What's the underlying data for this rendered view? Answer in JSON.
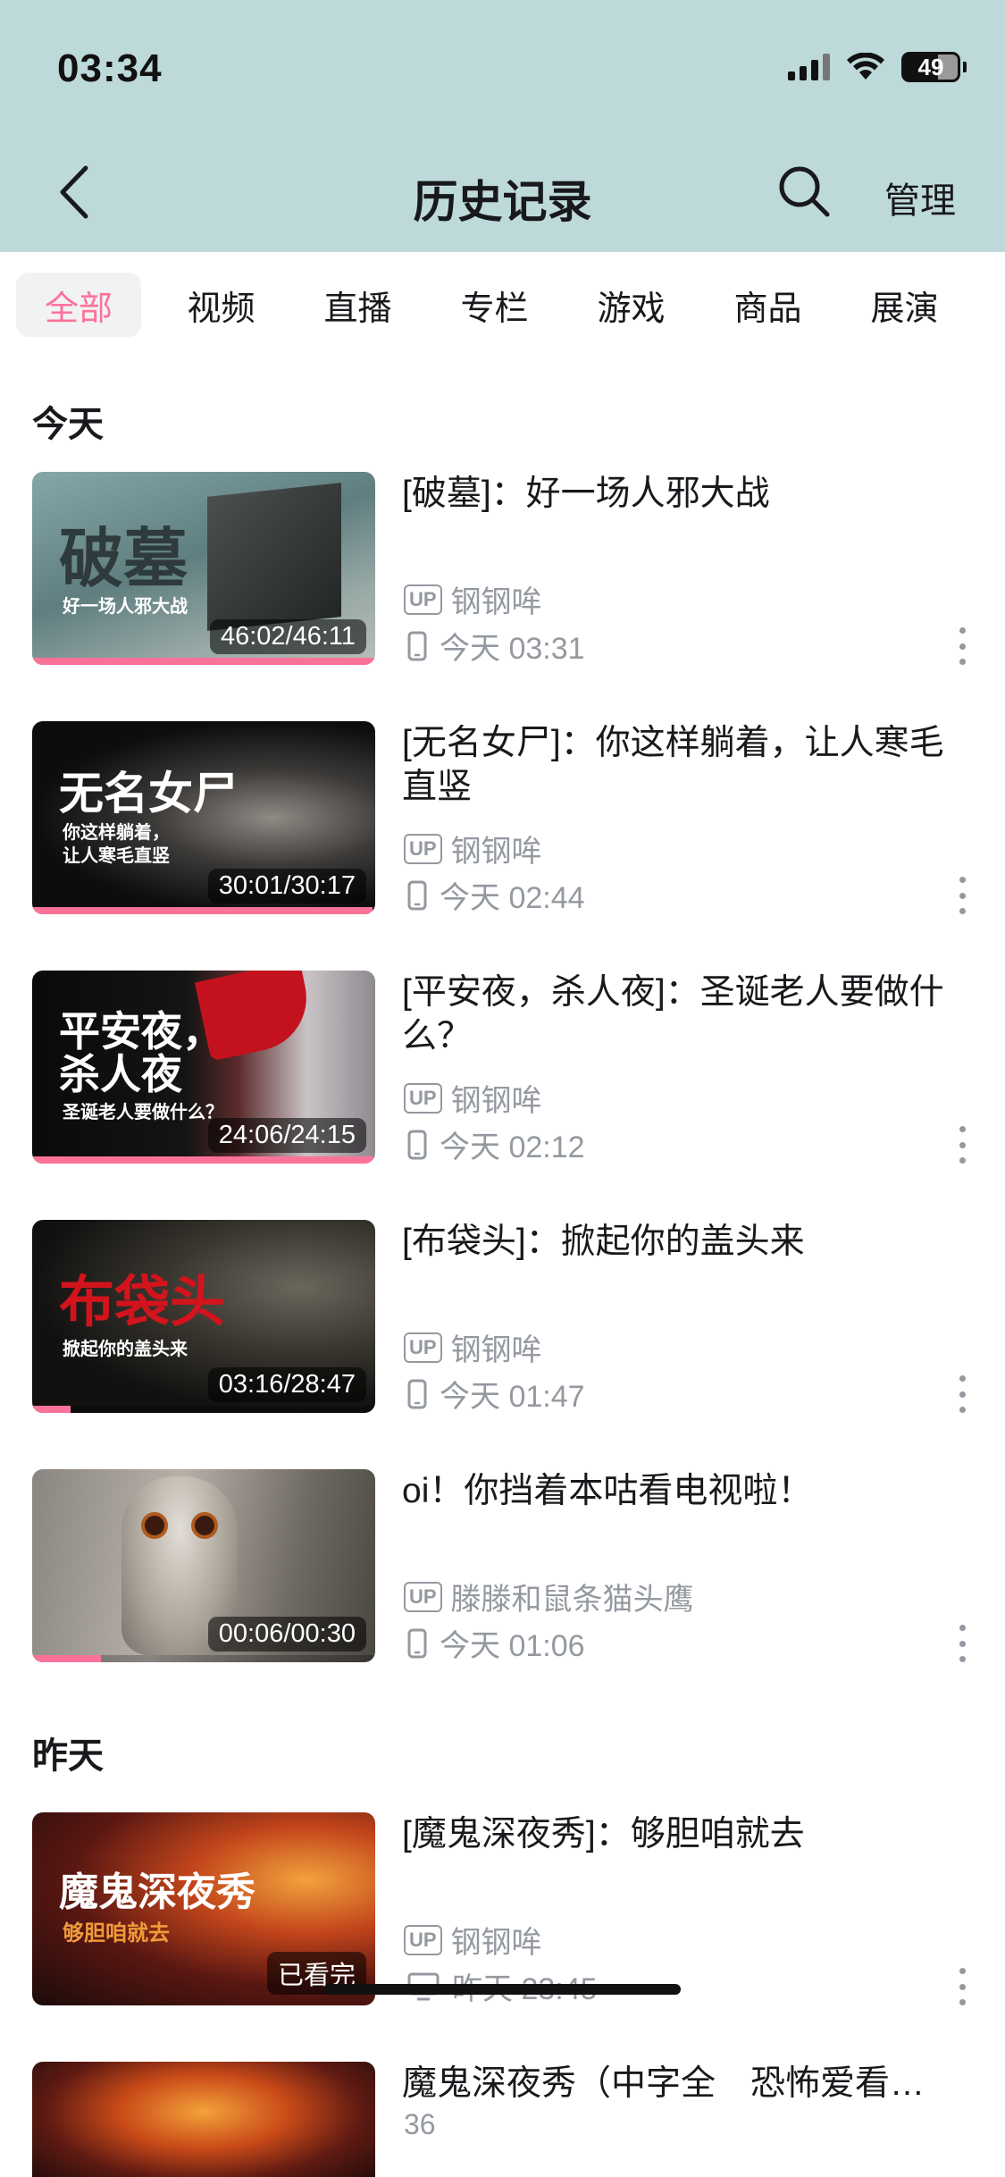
{
  "status": {
    "time": "03:34",
    "battery": "49"
  },
  "nav": {
    "title": "历史记录",
    "manage_label": "管理"
  },
  "tabs": [
    "全部",
    "视频",
    "直播",
    "专栏",
    "游戏",
    "商品",
    "展演"
  ],
  "sections": {
    "today": "今天",
    "yesterday": "昨天"
  },
  "items": [
    {
      "thumb_title": "破墓",
      "thumb_sub": "好一场人邪大战",
      "duration": "46:02/46:11",
      "progress": 0.997,
      "title": "[破墓]：好一场人邪大战",
      "up": "钢钢哞",
      "time": "今天 03:31",
      "device": "phone-icon"
    },
    {
      "thumb_title": "无名女尸",
      "thumb_sub": "你这样躺着，\n让人寒毛直竖",
      "duration": "30:01/30:17",
      "progress": 0.991,
      "title": "[无名女尸]：你这样躺着，让人寒毛直竖",
      "up": "钢钢哞",
      "time": "今天 02:44",
      "device": "phone-icon"
    },
    {
      "thumb_title": "平安夜，\n杀人夜",
      "thumb_sub": "圣诞老人要做什么？",
      "duration": "24:06/24:15",
      "progress": 0.994,
      "title": "[平安夜，杀人夜]：圣诞老人要做什么？",
      "up": "钢钢哞",
      "time": "今天 02:12",
      "device": "phone-icon"
    },
    {
      "thumb_title": "布袋头",
      "thumb_sub": "掀起你的盖头来",
      "duration": "03:16/28:47",
      "progress": 0.113,
      "title": "[布袋头]：掀起你的盖头来",
      "up": "钢钢哞",
      "time": "今天 01:47",
      "device": "phone-icon"
    },
    {
      "thumb_title": "",
      "thumb_sub": "",
      "duration": "00:06/00:30",
      "progress": 0.2,
      "title": "oi！你挡着本咕看电视啦！",
      "up": "滕滕和鼠条猫头鹰",
      "time": "今天 01:06",
      "device": "phone-icon"
    },
    {
      "thumb_title": "魔鬼深夜秀",
      "thumb_sub": "够胆咱就去",
      "duration": "已看完",
      "progress": 1.0,
      "title": "[魔鬼深夜秀]：够胆咱就去",
      "up": "钢钢哞",
      "time": "昨天 23:45",
      "device": "monitor-icon"
    },
    {
      "thumb_title": "",
      "thumb_sub": "",
      "duration": "",
      "progress": 0,
      "title": "魔鬼深夜秀（中字全　恐怖爱看…",
      "extra": "36"
    }
  ]
}
